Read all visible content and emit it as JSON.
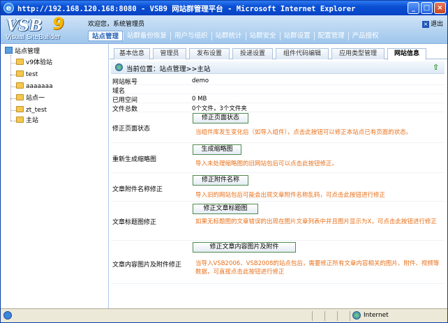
{
  "window": {
    "title": "http://192.168.120.168:8080 - VSB9 网站群管理平台 - Microsoft Internet Explorer"
  },
  "header": {
    "logo_text": "VSB",
    "logo_number": "9",
    "logo_subtitle": "Visual SiteBuilder",
    "welcome": "欢迎您，系统管理员",
    "logout": "退出"
  },
  "main_nav": [
    {
      "label": "站点管理",
      "active": true
    },
    {
      "label": "站群备份恢复"
    },
    {
      "label": "用户与组织"
    },
    {
      "label": "站群统计"
    },
    {
      "label": "站群安全"
    },
    {
      "label": "站群设置"
    },
    {
      "label": "配置管理"
    },
    {
      "label": "产品授权"
    }
  ],
  "tree": {
    "root": "站点管理",
    "items": [
      "v9体验站",
      "test",
      "aaaaaaa",
      "站点一",
      "zt_test",
      "主站"
    ]
  },
  "tabs": [
    "基本信息",
    "管理员",
    "发布设置",
    "投递设置",
    "组件代码编辑",
    "应用类型管理",
    "网站信息"
  ],
  "active_tab": "网站信息",
  "breadcrumb": "当前位置：站点管理>>主站",
  "info": {
    "account_label": "网站帐号",
    "account_value": "demo",
    "domain_label": "域名",
    "domain_value": "",
    "space_label": "已用空间",
    "space_value": "0 MB",
    "files_label": "文件总数",
    "files_value": "0个文件，3个文件夹"
  },
  "actions": [
    {
      "label": "修正页面状态",
      "button": "修正页面状态",
      "hint": "当组件库发生变化后（如导入组件），点击此按钮可以修正本站点已有页面的状态。"
    },
    {
      "label": "重新生成缩略图",
      "button": "生成缩略图",
      "hint": "导入未处理缩略图的旧网站包后可以点击此按钮修正。"
    },
    {
      "label": "文章附件名称修正",
      "button": "修正附件名称",
      "hint": "导入旧的网站包后可能会出现文章附件名称乱码，可点击此按钮进行修正"
    },
    {
      "label": "文章标题图修正",
      "button": "修正文章标题图",
      "hint": "如果无标题图的文章错误的出现在图片文章列表中并且图片显示为X，可点击此按钮进行修正"
    },
    {
      "label": "文章内容图片及附件修正",
      "button": "修正文章内容图片及附件",
      "hint": "当导入VSB2006、VSB2008的站点包后，需要修正所有文章内容相关的图片、附件、视频等数据，可直接点击此按钮进行修正"
    }
  ],
  "statusbar": {
    "zone": "Internet"
  }
}
